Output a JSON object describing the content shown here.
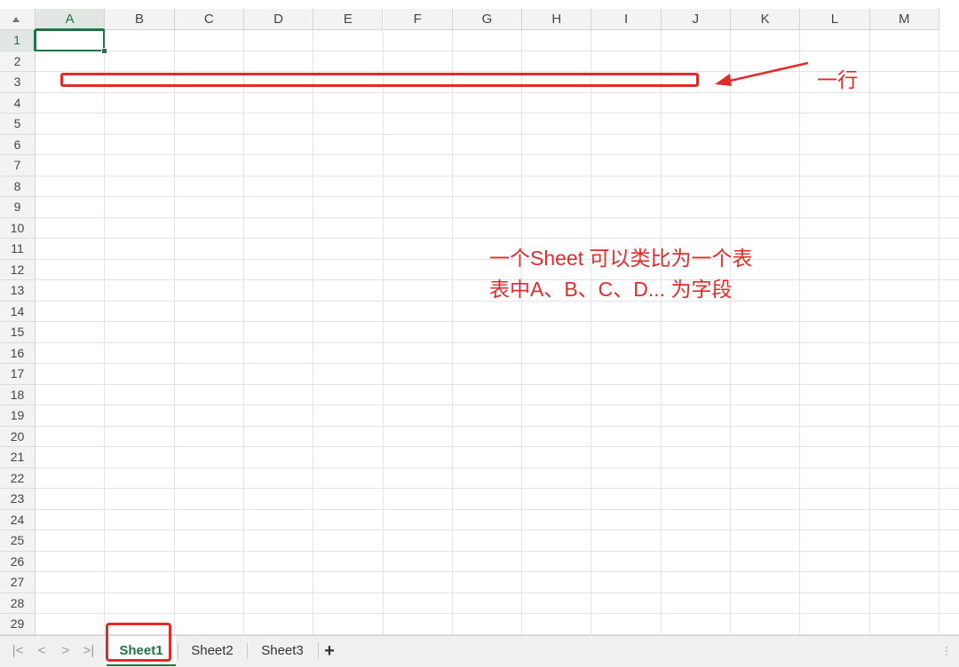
{
  "columns": [
    "A",
    "B",
    "C",
    "D",
    "E",
    "F",
    "G",
    "H",
    "I",
    "J",
    "K",
    "L",
    "M"
  ],
  "rows": [
    "1",
    "2",
    "3",
    "4",
    "5",
    "6",
    "7",
    "8",
    "9",
    "10",
    "11",
    "12",
    "13",
    "14",
    "15",
    "16",
    "17",
    "18",
    "19",
    "20",
    "21",
    "22",
    "23",
    "24",
    "25",
    "26",
    "27",
    "28",
    "29"
  ],
  "active_cell": {
    "column": "A",
    "row": "1"
  },
  "annotations": {
    "row_label": "一行",
    "sheet_line1": "一个Sheet  可以类比为一个表",
    "sheet_line2": "表中A、B、C、D... 为字段"
  },
  "sheet_tabs": {
    "nav": {
      "first": "|<",
      "prev": "<",
      "next": ">",
      "last": ">|"
    },
    "tabs": [
      {
        "label": "Sheet1",
        "active": true
      },
      {
        "label": "Sheet2",
        "active": false
      },
      {
        "label": "Sheet3",
        "active": false
      }
    ],
    "add_label": "+",
    "scroll_mark": "⋮"
  },
  "colors": {
    "accent": "#217346",
    "annotation": "#e02b2b"
  }
}
